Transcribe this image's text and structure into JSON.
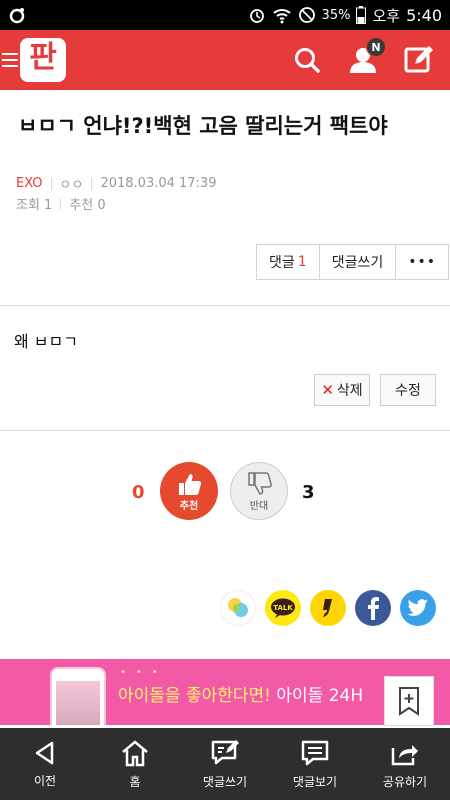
{
  "status_bar": {
    "battery_pct": "35%",
    "ampm": "오후",
    "time": "5:40"
  },
  "header": {
    "logo": "판",
    "notification_badge": "N"
  },
  "post": {
    "title": "ㅂㅁㄱ 언냐!?!백현 고음 딸리는거 팩트야",
    "category": "EXO",
    "author": "ㅇㅇ",
    "datetime": "2018.03.04 17:39",
    "views": "조회 1",
    "recommends": "추천 0",
    "body": "왜 ㅂㅁㄱ"
  },
  "comment_box": {
    "comment_label": "댓글",
    "comment_count": "1",
    "write_label": "댓글쓰기",
    "more": "•••"
  },
  "actions": {
    "delete_label": "삭제",
    "edit_label": "수정"
  },
  "votes": {
    "up_count": "0",
    "up_label": "추천",
    "down_label": "반대",
    "down_count": "3"
  },
  "ad": {
    "text_highlight": "아이돌을 좋아한다면!",
    "text_rest": " 아이돌 24H"
  },
  "bottom_nav": [
    {
      "label": "이전",
      "icon": "back-arrow-icon"
    },
    {
      "label": "홈",
      "icon": "home-icon"
    },
    {
      "label": "댓글쓰기",
      "icon": "write-comment-icon"
    },
    {
      "label": "댓글보기",
      "icon": "view-comments-icon"
    },
    {
      "label": "공유하기",
      "icon": "share-icon"
    }
  ],
  "colors": {
    "brand": "#e63b3b",
    "vote_up": "#e64a2e",
    "ad_pink": "#f25aa8",
    "nav_bg": "#2e2e2e"
  }
}
